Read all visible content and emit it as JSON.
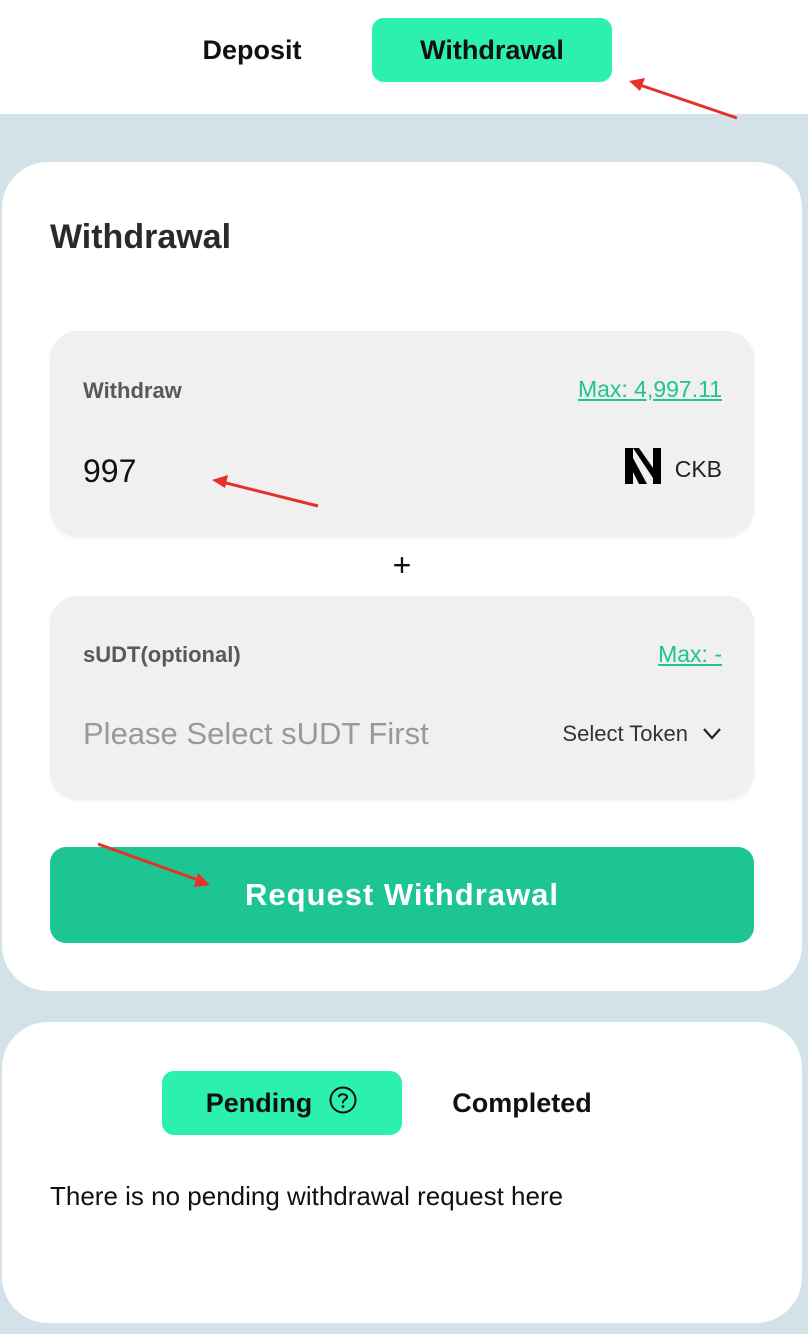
{
  "top_tabs": {
    "deposit": "Deposit",
    "withdrawal": "Withdrawal",
    "active": "withdrawal"
  },
  "withdrawal_card": {
    "title": "Withdrawal",
    "withdraw_panel": {
      "label": "Withdraw",
      "max_label": "Max: 4,997.11",
      "amount_value": "997",
      "token_symbol": "CKB",
      "token_icon": "nervos-logo-icon"
    },
    "plus_symbol": "+",
    "sudt_panel": {
      "label": "sUDT(optional)",
      "max_label": "Max: -",
      "placeholder": "Please Select sUDT First",
      "select_token_label": "Select Token"
    },
    "request_button_label": "Request Withdrawal"
  },
  "history_card": {
    "tabs": {
      "pending": "Pending",
      "completed": "Completed",
      "active": "pending"
    },
    "empty_message": "There is no pending withdrawal request here"
  },
  "colors": {
    "accent": "#2bf0b0",
    "button": "#1dc592",
    "link": "#1fc48e",
    "background": "#d3e2e9",
    "annotation_arrow": "#e8302a"
  }
}
